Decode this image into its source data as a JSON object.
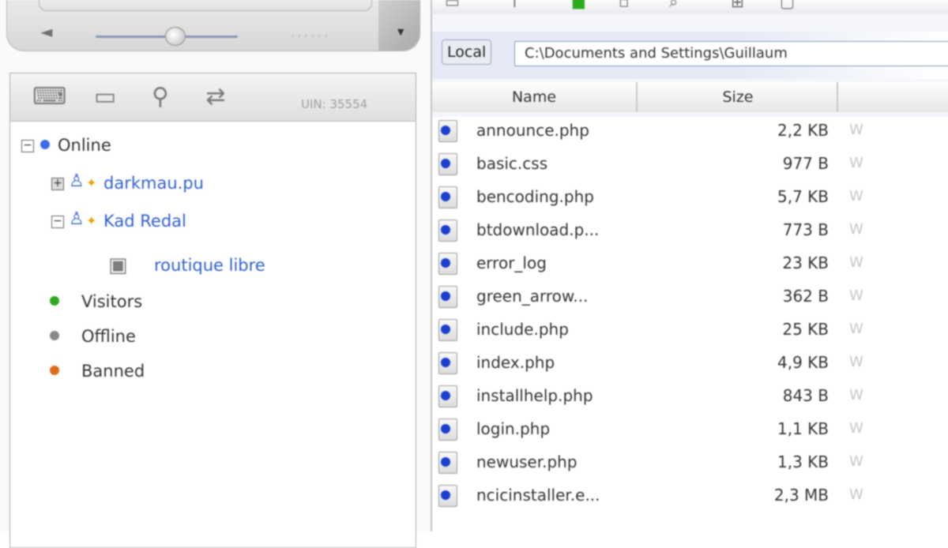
{
  "contacts_panel": {
    "uin_label": "UIN: 35554",
    "groups": {
      "online": "Online",
      "visitors": "Visitors",
      "offline": "Offline",
      "banned": "Banned"
    },
    "contacts": [
      {
        "name": "darkmau.pu"
      },
      {
        "name": "Kad Redal"
      }
    ],
    "sub_contact": "routique libre",
    "colors": {
      "online": "#3b6de8",
      "visitors": "#2eaa1f",
      "offline": "#888888",
      "banned": "#e06a1b",
      "contact_link": "#2f5fd1"
    }
  },
  "file_browser": {
    "location_label": "Local",
    "path": "C:\\Documents and Settings\\Guillaum",
    "columns": {
      "name": "Name",
      "size": "Size"
    },
    "files": [
      {
        "name": "announce.php",
        "size": "2,2 KB",
        "extra": "W"
      },
      {
        "name": "basic.css",
        "size": "977 B",
        "extra": "W"
      },
      {
        "name": "bencoding.php",
        "size": "5,7 KB",
        "extra": "W"
      },
      {
        "name": "btdownload.p...",
        "size": "773 B",
        "extra": "W"
      },
      {
        "name": "error_log",
        "size": "23 KB",
        "extra": "W"
      },
      {
        "name": "green_arrow...",
        "size": "362 B",
        "extra": "W"
      },
      {
        "name": "include.php",
        "size": "25 KB",
        "extra": "W"
      },
      {
        "name": "index.php",
        "size": "4,9 KB",
        "extra": "W"
      },
      {
        "name": "installhelp.php",
        "size": "843 B",
        "extra": "W"
      },
      {
        "name": "login.php",
        "size": "1,1 KB",
        "extra": "W"
      },
      {
        "name": "newuser.php",
        "size": "1,3 KB",
        "extra": "W"
      },
      {
        "name": "ncicinstaller.e...",
        "size": "2,3 MB",
        "extra": "W"
      }
    ]
  }
}
